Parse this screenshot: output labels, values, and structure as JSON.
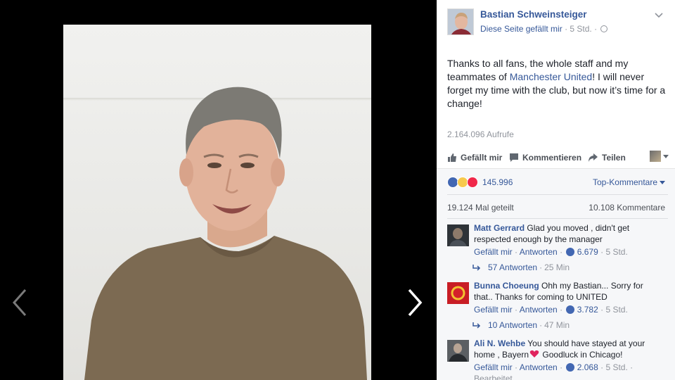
{
  "post": {
    "page_name": "Bastian Schweinsteiger",
    "like_page": "Diese Seite gefällt mir",
    "separator": "·",
    "time": "5 Std.",
    "text_before": "Thanks to all fans, the whole staff and my teammates of ",
    "text_link": "Manchester United",
    "text_after": "! I will never forget my time with the club, but now it’s time for a change!",
    "views": "2.164.096 Aufrufe"
  },
  "actions": {
    "like": "Gefällt mir",
    "comment": "Kommentieren",
    "share": "Teilen"
  },
  "stats": {
    "reaction_count": "145.996",
    "sort_label": "Top-Kommentare",
    "shares": "19.124 Mal geteilt",
    "comments": "10.108 Kommentare"
  },
  "comments": [
    {
      "author": "Matt Gerrard",
      "text": "Glad you moved , didn't get respected enough by the manager",
      "like": "Gefällt mir",
      "reply": "Antworten",
      "likes": "6.679",
      "time": "5 Std.",
      "replies": "57 Antworten",
      "replies_time": "25 Min"
    },
    {
      "author": "Bunna Choeung",
      "text": "Ohh my Bastian... Sorry for that.. Thanks for coming to UNITED",
      "like": "Gefällt mir",
      "reply": "Antworten",
      "likes": "3.782",
      "time": "5 Std.",
      "replies": "10 Antworten",
      "replies_time": "47 Min"
    },
    {
      "author": "Ali N. Wehbe",
      "text_before": "You should have stayed at your home , Bayern",
      "text_after": " Goodluck in Chicago!",
      "like": "Gefällt mir",
      "reply": "Antworten",
      "likes": "2.068",
      "time": "5 Std.",
      "edited": "Bearbeitet"
    }
  ],
  "colors": {
    "link": "#365899",
    "reaction_like": "#4267b2",
    "reaction_love": "#f0284a",
    "reaction_sad": "#f7c94d"
  },
  "icons": [
    "chevron-left-icon",
    "chevron-right-icon",
    "like-icon",
    "comment-icon",
    "share-icon",
    "globe-icon",
    "heart-icon"
  ]
}
